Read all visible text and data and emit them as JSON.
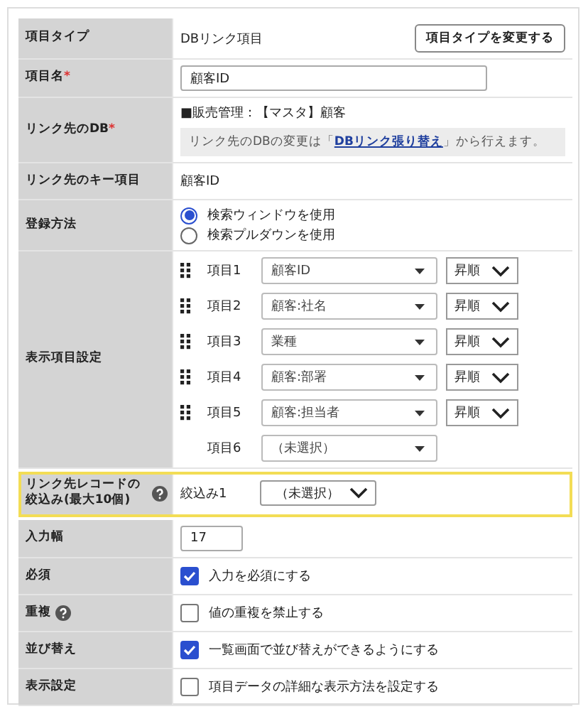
{
  "rows": [
    {
      "kind": "type",
      "label": "項目タイプ",
      "value": "DBリンク項目",
      "button": "項目タイプを変更する"
    },
    {
      "kind": "input",
      "label": "項目名",
      "required": "*",
      "value": "顧客ID"
    },
    {
      "kind": "db",
      "label": "リンク先のDB",
      "required": "*",
      "value": "■販売管理：【マスタ】顧客",
      "note_before": "リンク先のDBの変更は「",
      "link": "DBリンク張り替え",
      "note_after": "」から行えます。"
    },
    {
      "kind": "text",
      "label": "リンク先のキー項目",
      "value": "顧客ID"
    },
    {
      "kind": "radio",
      "label": "登録方法",
      "options": [
        {
          "label": "検索ウィンドウを使用",
          "selected": true
        },
        {
          "label": "検索プルダウンを使用",
          "selected": false
        }
      ]
    },
    {
      "kind": "items",
      "label": "表示項目設定",
      "items": [
        {
          "label": "項目1",
          "value": "顧客ID",
          "order": "昇順",
          "draggable": true
        },
        {
          "label": "項目2",
          "value": "顧客:社名",
          "order": "昇順",
          "draggable": true
        },
        {
          "label": "項目3",
          "value": "業種",
          "order": "昇順",
          "draggable": true
        },
        {
          "label": "項目4",
          "value": "顧客:部署",
          "order": "昇順",
          "draggable": true
        },
        {
          "label": "項目5",
          "value": "顧客:担当者",
          "order": "昇順",
          "draggable": true
        },
        {
          "label": "項目6",
          "value": "（未選択）",
          "draggable": false
        }
      ]
    },
    {
      "kind": "filter",
      "label": "リンク先レコードの絞込み(最大10個)",
      "help": true,
      "highlighted": true,
      "filter_label": "絞込み1",
      "value": "（未選択）"
    },
    {
      "kind": "small_input",
      "label": "入力幅",
      "value": "17"
    },
    {
      "kind": "checkbox",
      "label": "必須",
      "checked": true,
      "text": "入力を必須にする"
    },
    {
      "kind": "checkbox",
      "label": "重複",
      "help": true,
      "checked": false,
      "text": "値の重複を禁止する"
    },
    {
      "kind": "checkbox",
      "label": "並び替え",
      "checked": true,
      "text": "一覧画面で並び替えができるようにする"
    },
    {
      "kind": "checkbox",
      "label": "表示設定",
      "checked": false,
      "text": "項目データの詳細な表示方法を設定する"
    }
  ]
}
